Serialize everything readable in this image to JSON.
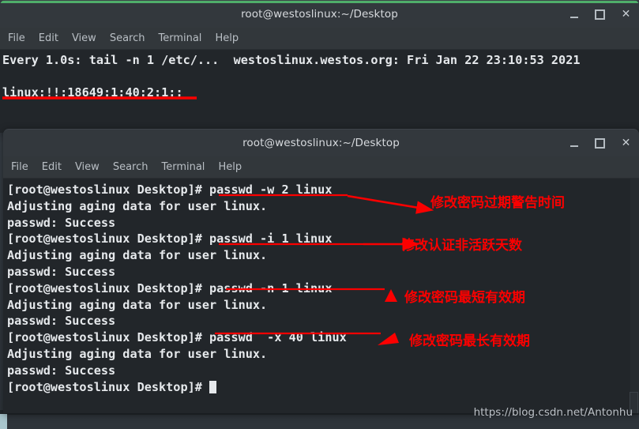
{
  "window1": {
    "title": "root@westoslinux:~/Desktop",
    "menu": [
      "File",
      "Edit",
      "View",
      "Search",
      "Terminal",
      "Help"
    ],
    "controls": {
      "minimize": "minimize-button",
      "maximize": "maximize-button",
      "close": "close-button"
    },
    "line1": "Every 1.0s: tail -n 1 /etc/...  westoslinux.westos.org: Fri Jan 22 23:10:53 2021",
    "line2": "linux:!!:18649:1:40:2:1::",
    "accent_color": "#4fae6a"
  },
  "window2": {
    "title": "root@westoslinux:~/Desktop",
    "menu": [
      "File",
      "Edit",
      "View",
      "Search",
      "Terminal",
      "Help"
    ],
    "controls": {
      "minimize": "minimize-button",
      "maximize": "maximize-button",
      "close": "close-button"
    },
    "lines": [
      "[root@westoslinux Desktop]# passwd -w 2 linux",
      "Adjusting aging data for user linux.",
      "passwd: Success",
      "[root@westoslinux Desktop]# passwd -i 1 linux",
      "Adjusting aging data for user linux.",
      "passwd: Success",
      "[root@westoslinux Desktop]# passwd -n 1 linux",
      "Adjusting aging data for user linux.",
      "passwd: Success",
      "[root@westoslinux Desktop]# passwd  -x 40 linux",
      "Adjusting aging data for user linux.",
      "passwd: Success"
    ],
    "prompt_last": "[root@westoslinux Desktop]# "
  },
  "annotations": {
    "color": "#fb0000",
    "labels": [
      "修改密码过期警告时间",
      "修改认证非活跃天数",
      "修改密码最短有效期",
      "修改密码最长有效期"
    ]
  },
  "watermark": "https://blog.csdn.net/Antonhu"
}
